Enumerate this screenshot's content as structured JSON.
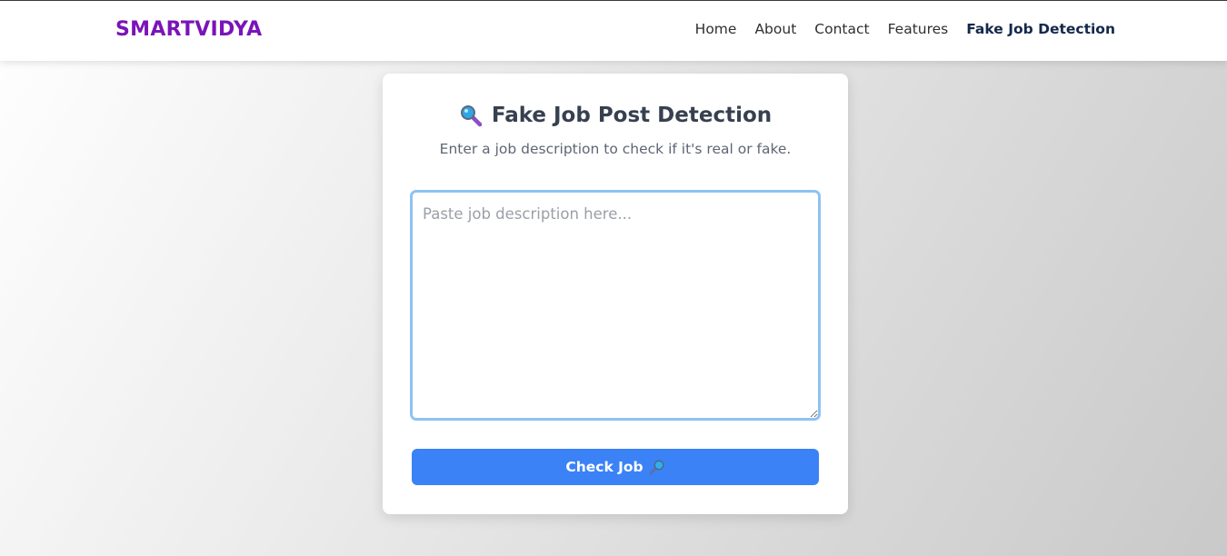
{
  "navbar": {
    "brand": "SMARTVIDYA",
    "links": [
      {
        "label": "Home"
      },
      {
        "label": "About"
      },
      {
        "label": "Contact"
      },
      {
        "label": "Features"
      },
      {
        "label": "Fake Job Detection",
        "active": true
      }
    ]
  },
  "card": {
    "title_icon": "magnifier-icon",
    "title": "Fake Job Post Detection",
    "subtitle": "Enter a job description to check if it's real or fake.",
    "textarea": {
      "value": "",
      "placeholder": "Paste job description here..."
    },
    "button": {
      "label": "Check Job",
      "icon": "magnifier-icon"
    }
  },
  "colors": {
    "brand": "#7a14b8",
    "active_link": "#14284b",
    "button": "#3b82f6",
    "input_focus_border": "#8ec2f3"
  }
}
